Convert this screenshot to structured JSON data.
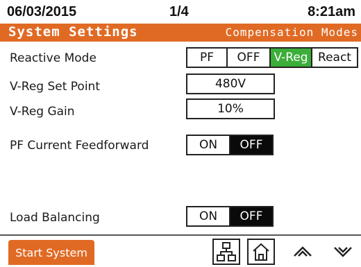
{
  "header": {
    "date": "06/03/2015",
    "page": "1/4",
    "time": "8:21am"
  },
  "titlebar": {
    "title": "System Settings",
    "subtitle": "Compensation Modes"
  },
  "settings": {
    "reactive_mode": {
      "label": "Reactive Mode",
      "options": [
        "PF",
        "OFF",
        "V-Reg",
        "React"
      ],
      "selected": "V-Reg"
    },
    "vreg_set_point": {
      "label": "V-Reg Set Point",
      "value": "480V"
    },
    "vreg_gain": {
      "label": "V-Reg Gain",
      "value": "10%"
    },
    "pf_feedforward": {
      "label": "PF Current Feedforward",
      "options": [
        "ON",
        "OFF"
      ],
      "selected": "OFF"
    },
    "load_balancing": {
      "label": "Load Balancing",
      "options": [
        "ON",
        "OFF"
      ],
      "selected": "OFF"
    }
  },
  "footer": {
    "start_button": "Start System",
    "icons": [
      "network-icon",
      "home-icon",
      "chevron-up-icon",
      "chevron-down-icon"
    ]
  },
  "colors": {
    "accent": "#e06a24",
    "selected_green": "#3cae3a",
    "selected_black": "#0a0a0a"
  }
}
